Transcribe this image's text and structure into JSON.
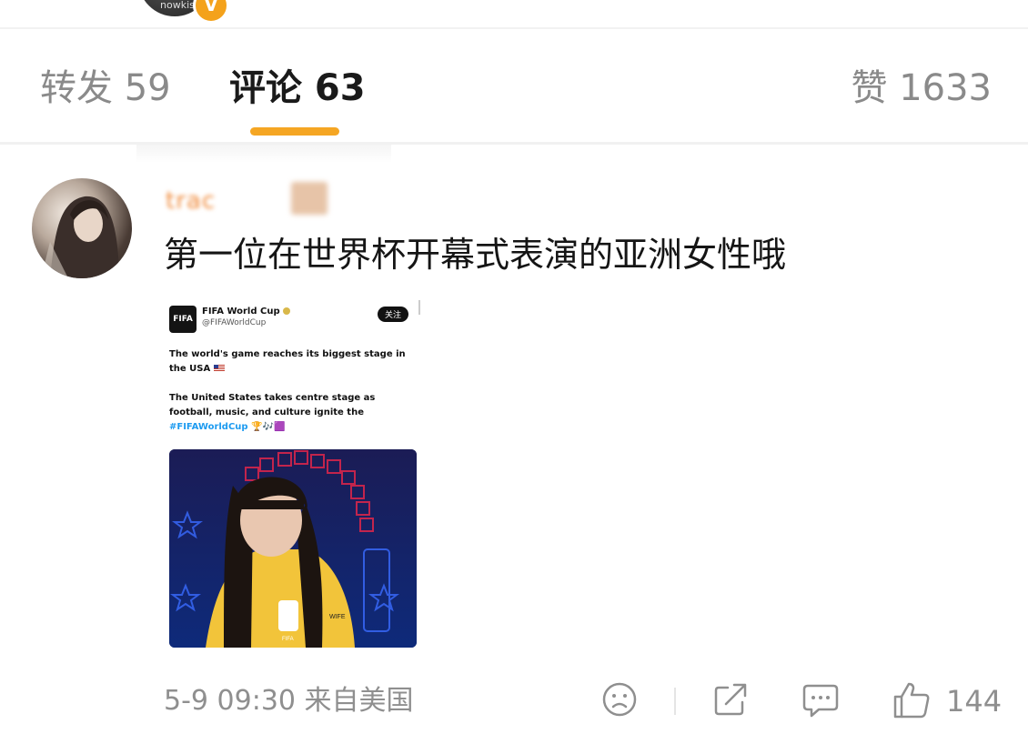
{
  "post": {
    "author_label": "nowkiss",
    "verified_badge": "V"
  },
  "tabs": {
    "repost": "转发 59",
    "comment": "评论 63",
    "like": "赞 1633"
  },
  "comment": {
    "username": "trac  ",
    "text": "第一位在世界杯开幕式表演的亚洲女性哦",
    "time": "5-9 09:30",
    "source": "来自美国",
    "like_count": "144",
    "embedded_post": {
      "account_name": "FIFA World Cup",
      "account_handle": "@FIFAWorldCup",
      "logo_text": "FIFA",
      "follow_label": "关注",
      "line1": "The world's game reaches its biggest stage in the USA",
      "line2a": "The United States takes centre stage as football, music, and culture ignite the",
      "hashtag": "#FIFAWorldCup",
      "emojis": "🏆🎶🟪",
      "image_logo_text": "FIFA",
      "image_watermark": "WIFE"
    }
  },
  "icons": [
    "dislike-face-icon",
    "share-icon",
    "comment-bubble-icon",
    "thumbs-up-icon",
    "verified-v-icon",
    "flag-usa-icon"
  ],
  "colors": {
    "accent": "#f5a623",
    "muted": "#8f8f8f",
    "username": "#f08a3a",
    "hashtag": "#1d9bf0"
  }
}
